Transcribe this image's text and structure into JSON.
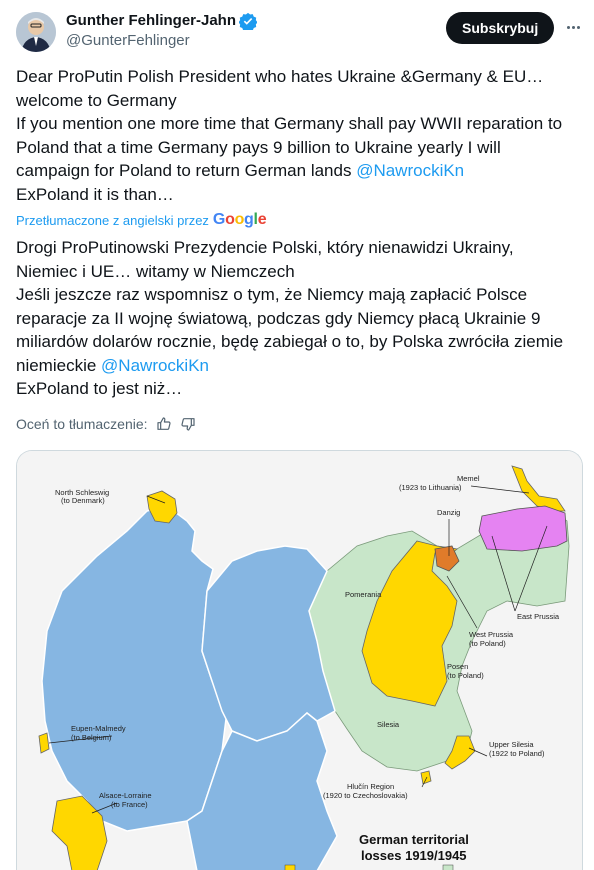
{
  "author": {
    "display_name": "Gunther Fehlinger-Jahn",
    "handle": "@GunterFehlinger",
    "avatar_icon": "avatar-photo",
    "verified_icon": "verified-badge-icon"
  },
  "actions": {
    "subscribe_label": "Subskrybuj",
    "more_icon": "more-options-icon"
  },
  "tweet": {
    "lines": [
      "Dear ProPutin Polish President who hates Ukraine &Germany & EU…",
      "welcome to Germany",
      "If you mention one more time that Germany shall pay WWII reparation to",
      "Poland that a time Germany pays 9 billion to Ukraine yearly I will",
      "campaign for Poland to return German lands ",
      "ExPoland it is than…"
    ],
    "mention": "@NawrockiKn"
  },
  "translation_note": {
    "label": "Przetłumaczone z angielski przez",
    "brand": [
      "G",
      "o",
      "o",
      "g",
      "l",
      "e"
    ]
  },
  "translation": {
    "lines": [
      "Drogi ProPutinowski Prezydencie Polski, który nienawidzi Ukrainy,",
      "Niemiec i UE… witamy w Niemczech",
      "Jeśli jeszcze raz wspomnisz o tym, że Niemcy mają zapłacić Polsce",
      "reparacje za II wojnę światową, podczas gdy Niemcy płacą Ukrainie 9",
      "miliardów dolarów rocznie, będę zabiegał o to, by Polska zwróciła ziemie",
      "niemieckie ",
      "ExPoland to jest niż…"
    ],
    "mention": "@NawrockiKn"
  },
  "rating": {
    "label": "Oceń to tłumaczenie:",
    "thumb_up_icon": "thumbs-up-icon",
    "thumb_down_icon": "thumbs-down-icon"
  },
  "map": {
    "title_line1": "German territorial",
    "title_line2": "losses 1919/1945",
    "labels": {
      "north_schleswig": [
        "North Schleswig",
        "(to Denmark)"
      ],
      "memel": [
        "Memel",
        "(1923 to Lithuania)"
      ],
      "danzig": [
        "Danzig"
      ],
      "pomerania": [
        "Pomerania"
      ],
      "east_prussia": [
        "East Prussia"
      ],
      "west_prussia": [
        "West Prussia",
        "(to Poland)"
      ],
      "posen": [
        "Posen",
        "(to Poland)"
      ],
      "silesia": [
        "Silesia"
      ],
      "eupen": [
        "Eupen-Malmedy",
        "(to Belgium)"
      ],
      "upper_silesia": [
        "Upper Silesia",
        "(1922 to Poland)"
      ],
      "hlucin": [
        "Hlučín Region",
        "(1920 to Czechoslovakia)"
      ],
      "alsace": [
        "Alsace-Lorraine",
        "(to France)"
      ]
    },
    "colors": {
      "germany": "#86b6e2",
      "lost_1919": "#ffd700",
      "lost_1945": "#c8e6c9",
      "memel_lithuania": "#e583f2",
      "danzig": "#e07b2a"
    }
  }
}
